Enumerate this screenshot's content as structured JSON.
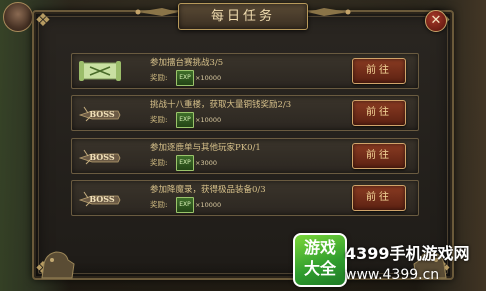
{
  "window": {
    "title": "每日任务"
  },
  "close": {
    "icon": "close-icon",
    "glyph": "✕"
  },
  "quests": [
    {
      "icon": "scroll-icon",
      "description": "参加擂台赛挑战3/5",
      "reward_label": "奖励:",
      "reward_type": "EXP",
      "reward_amount": "×10000",
      "button_label": "前往"
    },
    {
      "icon": "boss-icon",
      "description": "挑战十八重楼，获取大量铜钱奖励2/3",
      "reward_label": "奖励:",
      "reward_type": "EXP",
      "reward_amount": "×10000",
      "button_label": "前往"
    },
    {
      "icon": "boss-icon",
      "description": "参加逐鹿单与其他玩家PK0/1",
      "reward_label": "奖励:",
      "reward_type": "EXP",
      "reward_amount": "×3000",
      "button_label": "前往"
    },
    {
      "icon": "boss-icon",
      "description": "参加降魔录，获得极品装备0/3",
      "reward_label": "奖励:",
      "reward_type": "EXP",
      "reward_amount": "×10000",
      "button_label": "前往"
    }
  ],
  "watermark": {
    "logo_line1": "游戏",
    "logo_line2": "大全",
    "brand": "4399手机游戏网",
    "url": "www.4399.cn"
  },
  "colors": {
    "panel_border": "#6b5a3a",
    "button_bg": "#8a3b22",
    "button_text": "#f6d89a",
    "quest_text": "#d6c08a",
    "exp_badge": "#3f6f2a",
    "watermark_green": "#2f9c2e"
  }
}
